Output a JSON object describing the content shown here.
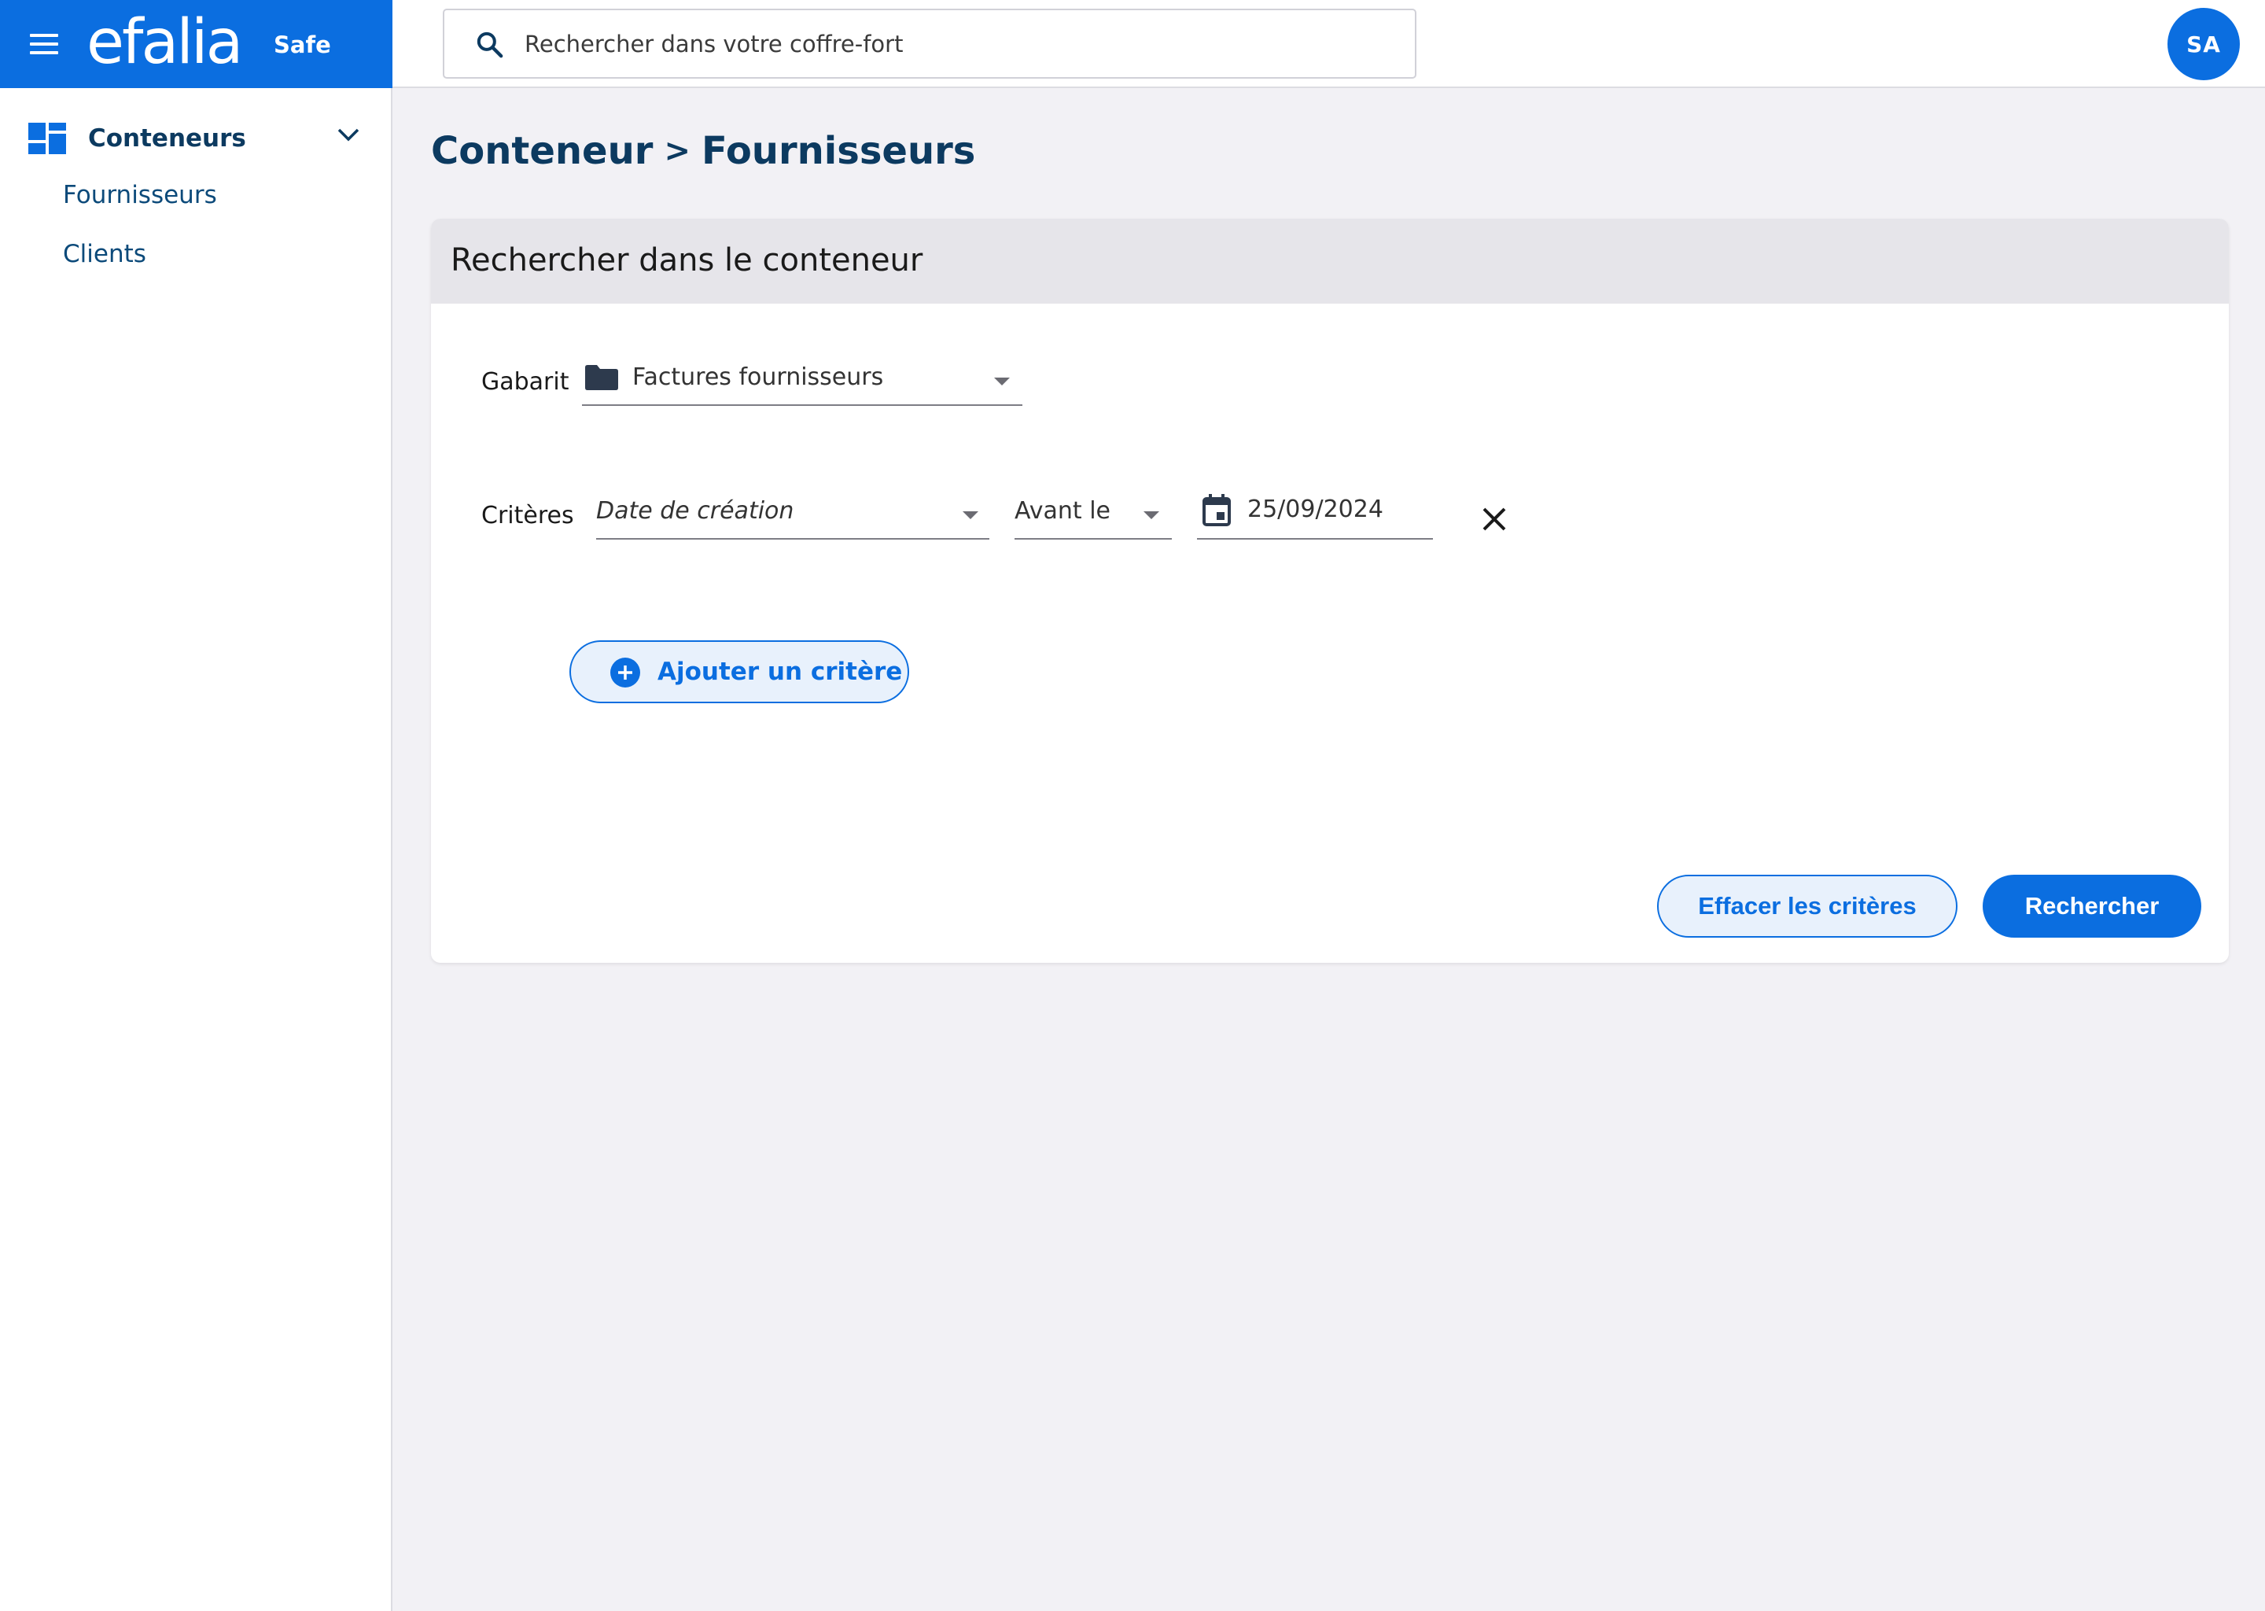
{
  "brand": {
    "logo": "efalia",
    "product": "Safe"
  },
  "search": {
    "placeholder": "Rechercher dans votre coffre-fort"
  },
  "user": {
    "initials": "SA"
  },
  "sidebar": {
    "group_label": "Conteneurs",
    "items": [
      {
        "label": "Fournisseurs"
      },
      {
        "label": "Clients"
      }
    ]
  },
  "breadcrumb": {
    "root": "Conteneur",
    "separator": ">",
    "current": "Fournisseurs"
  },
  "panel": {
    "title": "Rechercher dans le conteneur",
    "template_label": "Gabarit",
    "template_value": "Factures fournisseurs",
    "criteria_label": "Critères",
    "criterion": {
      "field": "Date de création",
      "operator": "Avant le",
      "date": "25/09/2024"
    },
    "add_criterion": "Ajouter un critère",
    "clear_button": "Effacer les critères",
    "search_button": "Rechercher"
  },
  "colors": {
    "accent": "#0b6ee0",
    "navy": "#0c3a60",
    "background": "#f2f1f5"
  }
}
